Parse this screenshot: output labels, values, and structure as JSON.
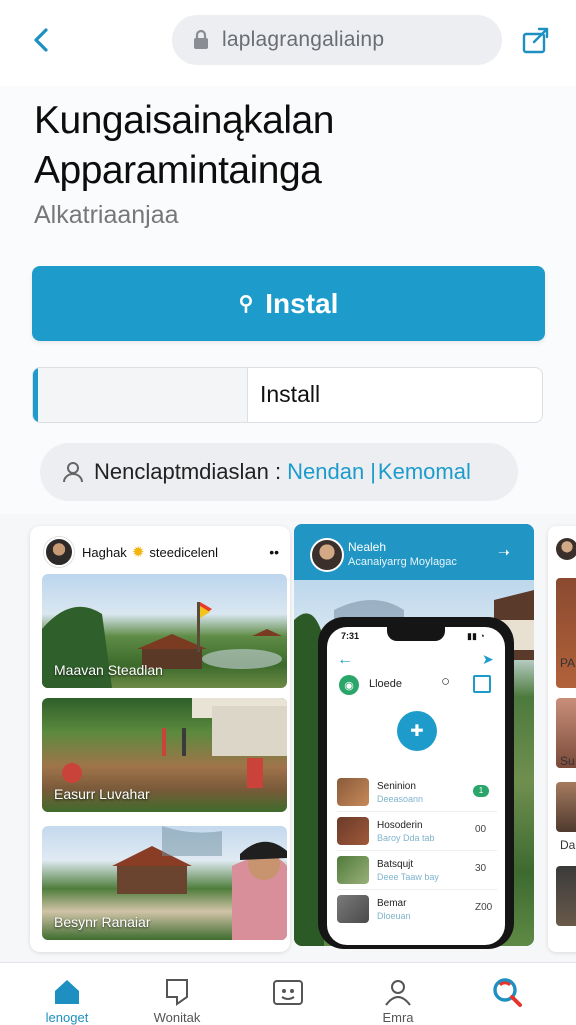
{
  "browser": {
    "url_text": "laplagrangaliainp",
    "back_icon": "chevron-left-icon",
    "share_icon": "share-icon"
  },
  "app": {
    "title_line1": "Kungaisainąkalan",
    "title_line2": "Apparamintainga",
    "subtitle": "Alkatriaanjaa",
    "install_primary_label": "Instal",
    "install_secondary_label": "Install",
    "install_progress": 0.42,
    "developer_label": "Nenclaptmdiaslan :",
    "developer_link": "Nendan",
    "developer_link2": "Kemomal",
    "accent_color": "#1d9ccc"
  },
  "screenshots": {
    "card1": {
      "user_name": "Haghak",
      "status_text": "steedicelenl",
      "photos": [
        {
          "caption": "Maavan Steadlan"
        },
        {
          "caption": "Easurr Luvahar"
        },
        {
          "caption": "Besynr Ranaiar"
        }
      ]
    },
    "card2": {
      "header_title": "Nealeh",
      "header_subtitle": "Acanaiyarrg Moylagac",
      "phone": {
        "time": "7:31",
        "app_name": "Lloede",
        "list": [
          {
            "name": "Seninion",
            "sub": "Deeasoann",
            "badge": "1"
          },
          {
            "name": "Hosoderin",
            "sub": "Baroy Dda tab",
            "value": "00"
          },
          {
            "name": "Batsqujt",
            "sub": "Deee Taaw bay",
            "value": "30"
          },
          {
            "name": "Bemar",
            "sub": "Dloeuan",
            "value": "Z00"
          }
        ]
      }
    },
    "card3": {
      "labels": [
        "PA",
        "Su",
        "Da"
      ]
    }
  },
  "tabbar": {
    "items": [
      {
        "label": "lenoget",
        "icon": "home-icon",
        "active": true
      },
      {
        "label": "Wonitak",
        "icon": "bookmark-icon",
        "active": false
      },
      {
        "label": "",
        "icon": "profile-card-icon",
        "active": false
      },
      {
        "label": "Emra",
        "icon": "people-icon",
        "active": false
      },
      {
        "label": "",
        "icon": "search-icon",
        "active": false
      }
    ]
  }
}
